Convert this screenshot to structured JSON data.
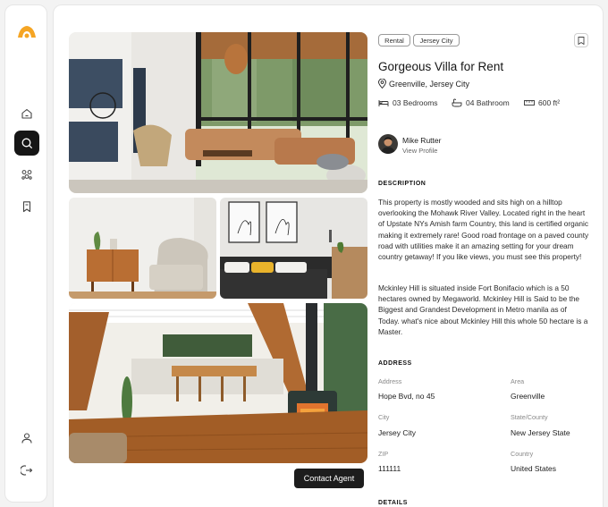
{
  "listing": {
    "tags": [
      "Rental",
      "Jersey City"
    ],
    "title": "Gorgeous Villa for Rent",
    "location": "Greenville, Jersey City",
    "features": {
      "bedrooms": "03 Bedrooms",
      "bathrooms": "04 Bathroom",
      "area": "600 ft²"
    }
  },
  "agent": {
    "name": "Mike Rutter",
    "link": "View Profile"
  },
  "description": {
    "heading": "DESCRIPTION",
    "paragraphs": [
      "This property is mostly wooded and sits high on a hilltop overlooking the Mohawk River Valley. Located right in the heart of Upstate NYs Amish farm Country, this land is certified organic making it extremely rare! Good road frontage on a paved county road with utilities make it an amazing setting for your dream country getaway! If you like views, you must see this property!",
      "Mckinley Hill is situated inside Fort Bonifacio which is a 50 hectares owned by Megaworld. Mckinley Hill is Said to be the Biggest and Grandest Development in Metro manila as of Today. what's nice about Mckinley Hill this whole 50 hectare is a Master."
    ]
  },
  "address": {
    "heading": "ADDRESS",
    "fields": {
      "address": {
        "label": "Address",
        "value": "Hope Bvd, no 45"
      },
      "area": {
        "label": "Area",
        "value": "Greenville"
      },
      "city": {
        "label": "City",
        "value": "Jersey City"
      },
      "state": {
        "label": "State/County",
        "value": "New Jersey State"
      },
      "zip": {
        "label": "ZIP",
        "value": "111111"
      },
      "country": {
        "label": "Country",
        "value": "United States"
      }
    }
  },
  "details": {
    "heading": "DETAILS"
  },
  "contact_button": "Contact Agent",
  "sidebar": {
    "top_icons": [
      "home-icon",
      "search-icon",
      "community-icon",
      "bookmark-icon"
    ],
    "bottom_icons": [
      "user-icon",
      "logout-icon"
    ],
    "active": "search-icon"
  },
  "colors": {
    "brand": "#f5a524",
    "dark": "#161616",
    "background": "#f3f3f3"
  }
}
